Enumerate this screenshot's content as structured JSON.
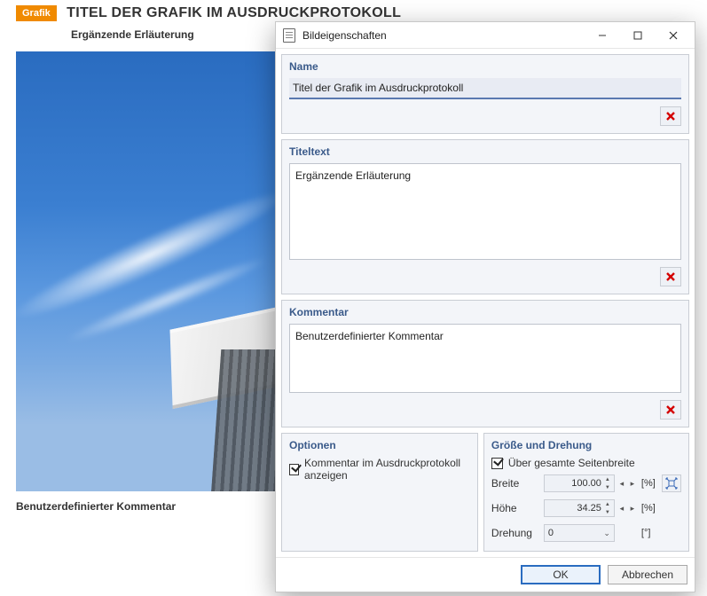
{
  "report": {
    "badge": "Grafik",
    "title": "TITEL DER GRAFIK IM AUSDRUCKPROTOKOLL",
    "subtitle": "Ergänzende Erläuterung",
    "comment": "Benutzerdefinierter Kommentar"
  },
  "dialog": {
    "caption": "Bildeigenschaften",
    "groups": {
      "name": {
        "title": "Name",
        "value": "Titel der Grafik im Ausdruckprotokoll"
      },
      "titletext": {
        "title": "Titeltext",
        "value": "Ergänzende Erläuterung"
      },
      "comment": {
        "title": "Kommentar",
        "value": "Benutzerdefinierter Kommentar"
      },
      "options": {
        "title": "Optionen",
        "show_comment_label": "Kommentar im Ausdruckprotokoll anzeigen"
      },
      "size": {
        "title": "Größe und Drehung",
        "full_width_label": "Über gesamte Seitenbreite",
        "width_label": "Breite",
        "width_value": "100.00",
        "height_label": "Höhe",
        "height_value": "34.25",
        "percent_unit": "[%]",
        "rotation_label": "Drehung",
        "rotation_value": "0",
        "rotation_unit": "[°]"
      }
    },
    "buttons": {
      "ok": "OK",
      "cancel": "Abbrechen"
    }
  }
}
